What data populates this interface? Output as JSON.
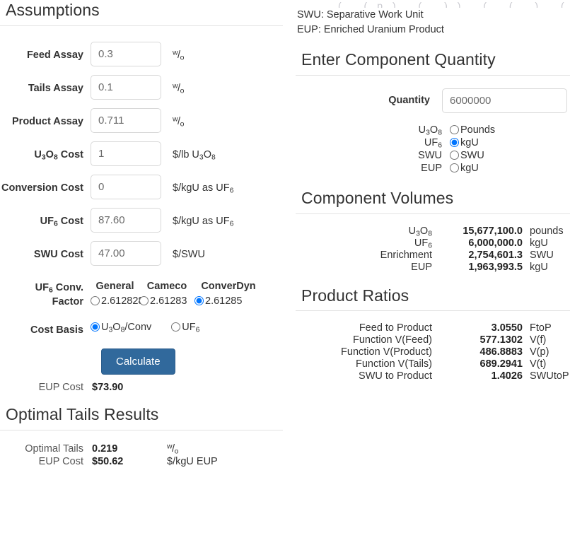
{
  "left": {
    "heading": "Assumptions",
    "fields": [
      {
        "label_html": "Feed Assay",
        "label": "Feed Assay",
        "value": "0.3",
        "unit": "w/o"
      },
      {
        "label_html": "Tails Assay",
        "label": "Tails Assay",
        "value": "0.1",
        "unit": "w/o"
      },
      {
        "label_html": "Product Assay",
        "label": "Product Assay",
        "value": "0.711",
        "unit": "w/o"
      },
      {
        "label_html": "U3O8 Cost",
        "label": "U3O8 Cost",
        "value": "1",
        "unit": "$/lb U3O8"
      },
      {
        "label_html": "Conversion Cost",
        "label": "Conversion Cost",
        "value": "0",
        "unit": "$/kgU as UF6"
      },
      {
        "label_html": "UF6 Cost",
        "label": "UF6 Cost",
        "value": "87.60",
        "unit": "$/kgU as UF6"
      },
      {
        "label_html": "SWU Cost",
        "label": "SWU Cost",
        "value": "47.00",
        "unit": "$/SWU"
      }
    ],
    "conv_factor": {
      "label": "UF6 Conv. Factor",
      "columns": [
        "General",
        "Cameco",
        "ConverDyn"
      ],
      "options": [
        {
          "value": "2.612828",
          "selected": false
        },
        {
          "value": "2.61283",
          "selected": false
        },
        {
          "value": "2.61285",
          "selected": true
        }
      ]
    },
    "cost_basis": {
      "label": "Cost Basis",
      "options": [
        {
          "value": "U3O8/Conv",
          "selected": true
        },
        {
          "value": "UF6",
          "selected": false
        }
      ]
    },
    "calculate_button": "Calculate",
    "eup_cost": {
      "label": "EUP Cost",
      "value": "$73.90",
      "unit": ""
    },
    "optimal_heading": "Optimal Tails Results",
    "optimal_rows": [
      {
        "label": "Optimal Tails",
        "value": "0.219",
        "unit": "w/o"
      },
      {
        "label": "EUP Cost",
        "value": "$50.62",
        "unit": "$/kgU EUP"
      }
    ]
  },
  "right": {
    "clipped_formula": "( (p) ( ))      ( ( )   ( ))",
    "abbreviations": [
      "SWU: Separative Work Unit",
      "EUP: Enriched Uranium Product"
    ],
    "quantity_heading": "Enter Component Quantity",
    "quantity": {
      "label": "Quantity",
      "value": "6000000"
    },
    "component_options": [
      {
        "label": "U3O8",
        "option": "Pounds",
        "selected": false
      },
      {
        "label": "UF6",
        "option": "kgU",
        "selected": true
      },
      {
        "label": "SWU",
        "option": "SWU",
        "selected": false
      },
      {
        "label": "EUP",
        "option": "kgU",
        "selected": false
      }
    ],
    "volumes_heading": "Component Volumes",
    "volumes": [
      {
        "label": "U3O8",
        "value": "15,677,100.0",
        "unit": "pounds"
      },
      {
        "label": "UF6",
        "value": "6,000,000.0",
        "unit": "kgU"
      },
      {
        "label": "Enrichment",
        "value": "2,754,601.3",
        "unit": "SWU"
      },
      {
        "label": "EUP",
        "value": "1,963,993.5",
        "unit": "kgU"
      }
    ],
    "ratios_heading": "Product Ratios",
    "ratios": [
      {
        "label": "Feed to Product",
        "value": "3.0550",
        "unit": "FtoP"
      },
      {
        "label": "Function V(Feed)",
        "value": "577.1302",
        "unit": "V(f)"
      },
      {
        "label": "Function V(Product)",
        "value": "486.8883",
        "unit": "V(p)"
      },
      {
        "label": "Function V(Tails)",
        "value": "689.2941",
        "unit": "V(t)"
      },
      {
        "label": "SWU to Product",
        "value": "1.4026",
        "unit": "SWUtoP"
      }
    ]
  },
  "colors": {
    "primary_button": "#31699c",
    "heading_text": "#333333",
    "input_border": "#d8d8d8",
    "rule": "#e2e2e2"
  }
}
